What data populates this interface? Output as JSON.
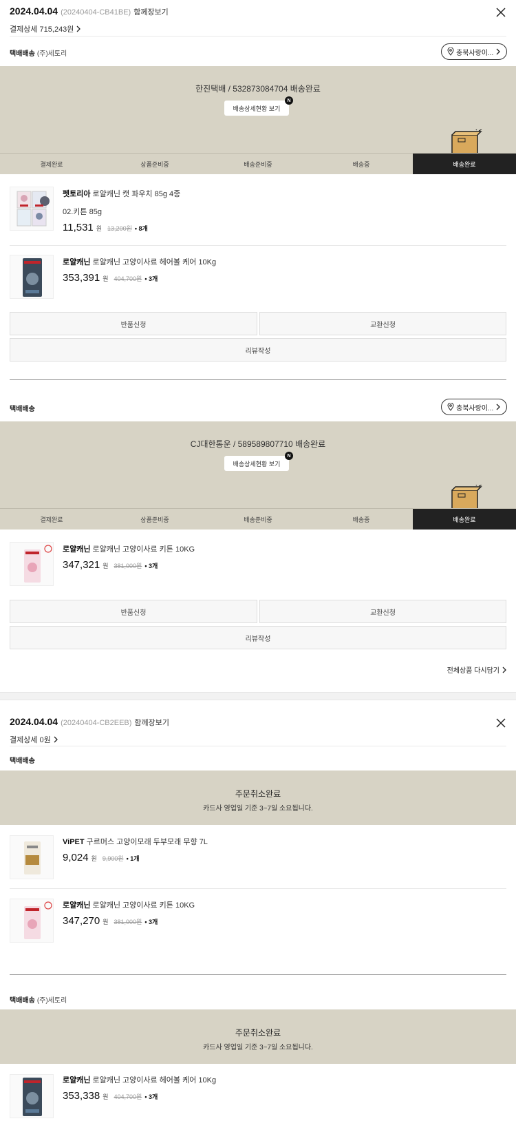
{
  "orders": [
    {
      "date": "2024.04.04",
      "order_no": "(20240404-CB41BE)",
      "together": "함께장보기",
      "pay_detail": "결제상세 715,243원",
      "shipments": [
        {
          "title": "택배배송",
          "seller": "(주)세토리",
          "location": "충북사랑이...",
          "tracking": "한진택배 / 532873084704 배송완료",
          "detail_btn": "배송상세현황 보기",
          "badge": "N",
          "steps": [
            "결제완료",
            "상품준비중",
            "배송준비중",
            "배송중",
            "배송완료"
          ],
          "active_step": 4,
          "products": [
            {
              "brand": "펫토리아",
              "name": "로얄캐닌 캣 파우치 85g 4종",
              "option": "02.키튼 85g",
              "price": "11,531",
              "won": "원",
              "orig": "13,200원",
              "qty": "• 8개"
            },
            {
              "brand": "로얄캐닌",
              "name": "로얄캐닌 고양이사료 헤어볼 케어 10Kg",
              "price": "353,391",
              "won": "원",
              "orig": "404,700원",
              "qty": "• 3개"
            }
          ],
          "buttons": {
            "return": "반품신청",
            "exchange": "교환신청",
            "review": "리뷰작성"
          }
        },
        {
          "title": "택배배송",
          "location": "충북사랑이...",
          "tracking": "CJ대한통운 / 589589807710 배송완료",
          "detail_btn": "배송상세현황 보기",
          "badge": "N",
          "steps": [
            "결제완료",
            "상품준비중",
            "배송준비중",
            "배송중",
            "배송완료"
          ],
          "active_step": 4,
          "products": [
            {
              "brand": "로얄캐닌",
              "name": "로얄캐닌 고양이사료 키튼 10KG",
              "price": "347,321",
              "won": "원",
              "orig": "381,000원",
              "qty": "• 3개"
            }
          ],
          "buttons": {
            "return": "반품신청",
            "exchange": "교환신청",
            "review": "리뷰작성"
          },
          "reorder": "전체상품 다시담기"
        }
      ]
    },
    {
      "date": "2024.04.04",
      "order_no": "(20240404-CB2EEB)",
      "together": "함께장보기",
      "pay_detail": "결제상세 0원",
      "shipments": [
        {
          "title": "택배배송",
          "cancel_title": "주문취소완료",
          "cancel_sub": "카드사 영업일 기준 3~7일 소요됩니다.",
          "products": [
            {
              "brand": "ViPET",
              "name": "구르머스 고양이모래 두부모래 무향 7L",
              "price": "9,024",
              "won": "원",
              "orig": "9,900원",
              "qty": "• 1개"
            },
            {
              "brand": "로얄캐닌",
              "name": "로얄캐닌 고양이사료 키튼 10KG",
              "price": "347,270",
              "won": "원",
              "orig": "381,000원",
              "qty": "• 3개"
            }
          ]
        },
        {
          "title": "택배배송",
          "seller": "(주)세토리",
          "cancel_title": "주문취소완료",
          "cancel_sub": "카드사 영업일 기준 3~7일 소요됩니다.",
          "products": [
            {
              "brand": "로얄캐닌",
              "name": "로얄캐닌 고양이사료 헤어볼 케어 10Kg",
              "price": "353,338",
              "won": "원",
              "orig": "404,700원",
              "qty": "• 3개"
            }
          ]
        }
      ]
    }
  ],
  "colors": {
    "beige": "#d7d3c5",
    "active_step": "#222222",
    "box": "#d9a95c"
  }
}
